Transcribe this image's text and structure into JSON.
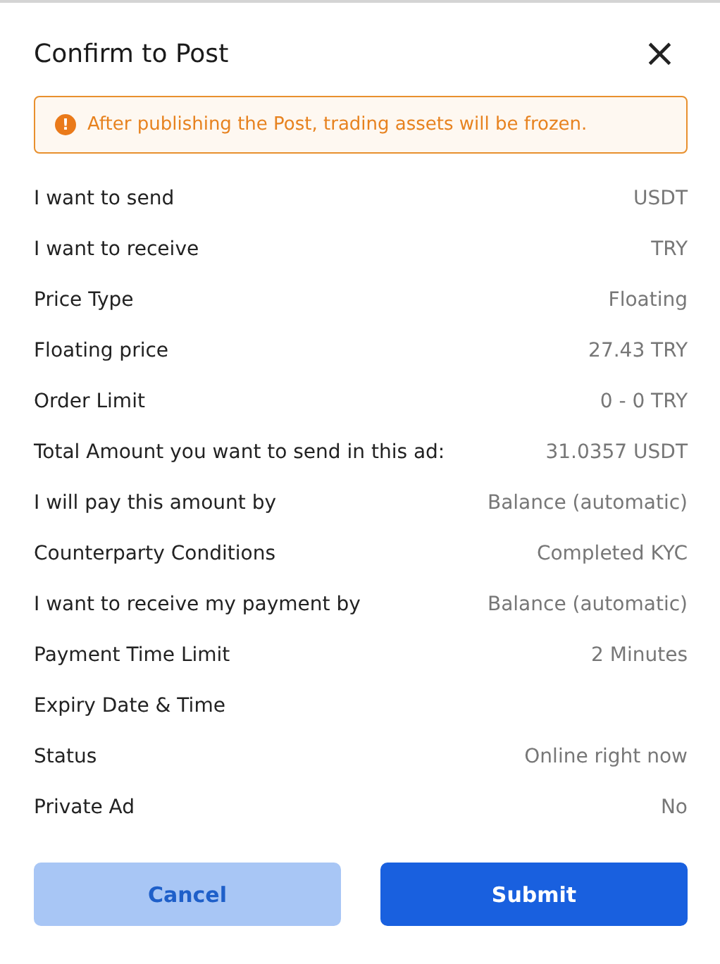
{
  "dialog": {
    "title": "Confirm to Post",
    "close": "×"
  },
  "warning": {
    "icon": "!",
    "text": "After publishing the Post, trading assets will be frozen."
  },
  "rows": [
    {
      "label": "I want to send",
      "value": "USDT"
    },
    {
      "label": "I want to receive",
      "value": "TRY"
    },
    {
      "label": "Price Type",
      "value": "Floating"
    },
    {
      "label": "Floating price",
      "value": "27.43 TRY"
    },
    {
      "label": "Order Limit",
      "value": "0 - 0 TRY"
    },
    {
      "label": "Total Amount you want to send in this ad:",
      "value": "31.0357 USDT"
    },
    {
      "label": "I will pay this amount by",
      "value": "Balance (automatic)"
    },
    {
      "label": "Counterparty Conditions",
      "value": "Completed KYC"
    },
    {
      "label": "I want to receive my payment by",
      "value": "Balance (automatic)"
    },
    {
      "label": "Payment Time Limit",
      "value": "2 Minutes"
    },
    {
      "label": "Expiry Date & Time"
    },
    {
      "label": "Status",
      "value": "Online right now"
    },
    {
      "label": "Private Ad",
      "value": "No"
    }
  ],
  "buttons": [
    {
      "label": "Cancel",
      "kind": "secondary"
    },
    {
      "label": "Submit",
      "kind": "primary"
    }
  ]
}
